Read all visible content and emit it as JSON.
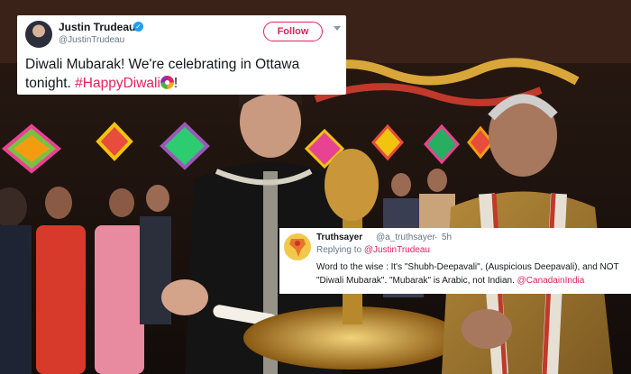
{
  "tweet1": {
    "display_name": "Justin Trudeau",
    "handle": "@JustinTrudeau",
    "verified_mark": "✓",
    "follow_label": "Follow",
    "text_main": "Diwali Mubarak! We're celebrating in Ottawa tonight. ",
    "hashtag": "#HappyDiwali",
    "text_end": "!",
    "hashtag_color": "#e0245e",
    "icons": [
      "avatar",
      "verified-badge-icon",
      "caret-down-icon",
      "rangoli-emoji-icon"
    ]
  },
  "tweet2": {
    "display_name": "Truthsayer",
    "handle": "@a_truthsayer",
    "separator": "·",
    "time": "5h",
    "replying_prefix": "Replying to ",
    "replying_to": "@JustinTrudeau",
    "body": "Word to the wise : It's \"Shubh-Deepavali\", (Auspicious Deepavali), and NOT \"Diwali Mubarak\". \"Mubarak\" is Arabic, not Indian. ",
    "mention": "@CanadainIndia",
    "link_color": "#e0245e",
    "icons": [
      "avatar-map-icon"
    ]
  },
  "photo": {
    "description_icons": [
      "diya-lamp-icon",
      "paper-lantern-icon"
    ]
  }
}
